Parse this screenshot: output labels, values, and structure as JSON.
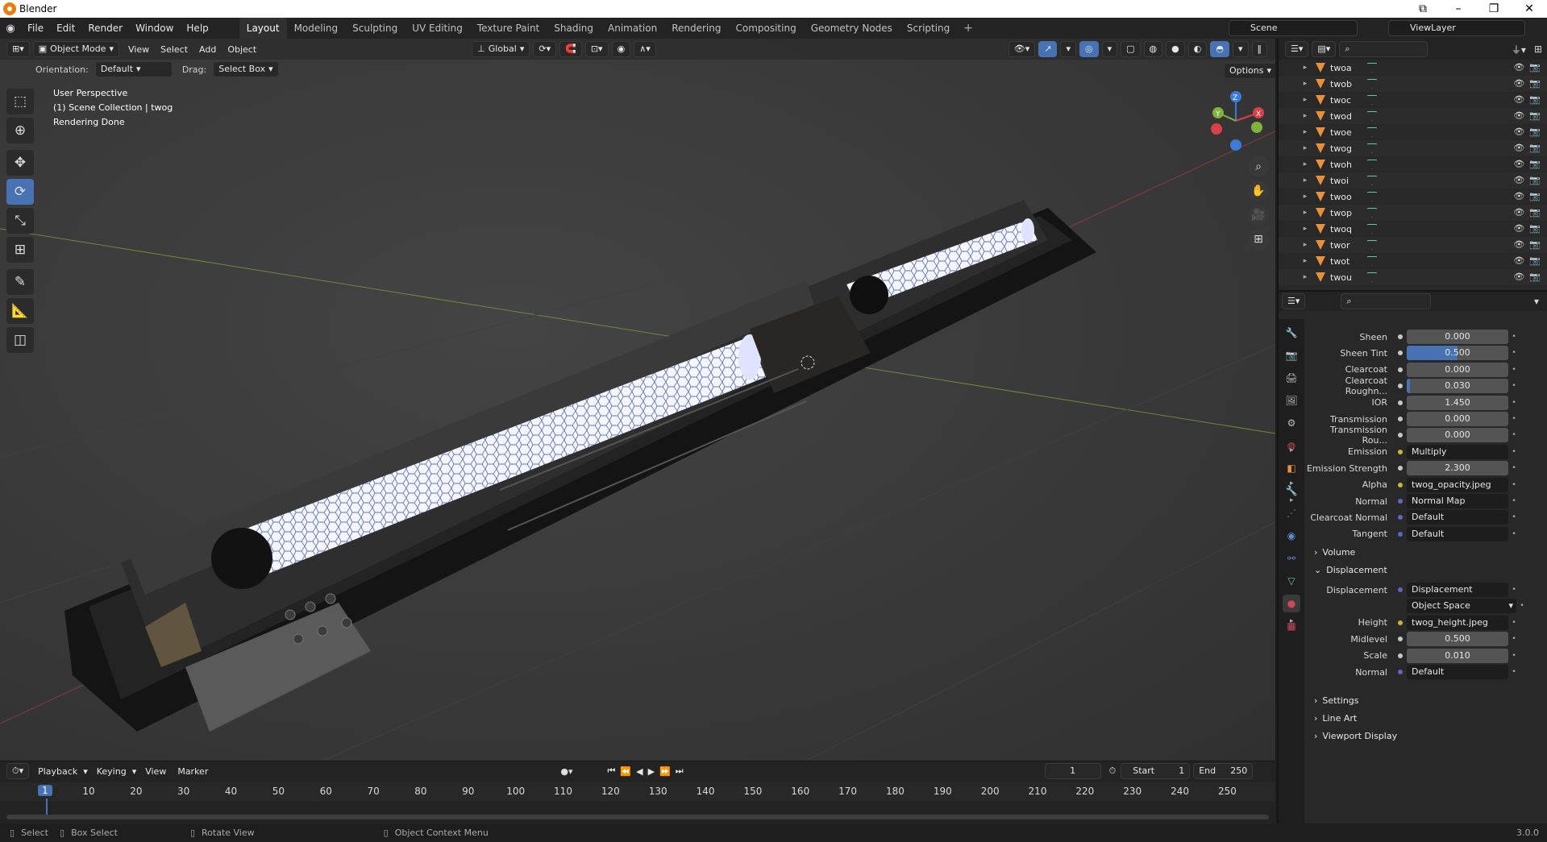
{
  "app": {
    "title": "Blender",
    "version": "3.0.0"
  },
  "menus": [
    "File",
    "Edit",
    "Render",
    "Window",
    "Help"
  ],
  "workspaces": [
    "Layout",
    "Modeling",
    "Sculpting",
    "UV Editing",
    "Texture Paint",
    "Shading",
    "Animation",
    "Rendering",
    "Compositing",
    "Geometry Nodes",
    "Scripting"
  ],
  "active_workspace": "Layout",
  "scene": {
    "name": "Scene",
    "view_layer": "ViewLayer"
  },
  "viewport": {
    "mode": "Object Mode",
    "menus": [
      "View",
      "Select",
      "Add",
      "Object"
    ],
    "transform": "Global",
    "orientation_label": "Orientation:",
    "orientation": "Default",
    "drag_label": "Drag:",
    "drag": "Select Box",
    "options": "Options",
    "overlay_lines": [
      "User Perspective",
      "(1) Scene Collection | twog",
      "Rendering Done"
    ]
  },
  "timeline": {
    "menus": [
      "Playback",
      "Keying",
      "View",
      "Marker"
    ],
    "current_frame": "1",
    "start_label": "Start",
    "start": "1",
    "end_label": "End",
    "end": "250",
    "ticks": [
      "10",
      "20",
      "30",
      "40",
      "50",
      "60",
      "70",
      "80",
      "90",
      "100",
      "110",
      "120",
      "130",
      "140",
      "150",
      "160",
      "170",
      "180",
      "190",
      "200",
      "210",
      "220",
      "230",
      "240",
      "250"
    ],
    "cur_tick": "1"
  },
  "statusbar": {
    "select": "Select",
    "box_select": "Box Select",
    "rotate": "Rotate View",
    "context": "Object Context Menu",
    "version": "3.0.0"
  },
  "outliner": {
    "items": [
      "twoa",
      "twob",
      "twoc",
      "twod",
      "twoe",
      "twog",
      "twoh",
      "twoi",
      "twoo",
      "twop",
      "twoq",
      "twor",
      "twot",
      "twou"
    ],
    "active": "twog"
  },
  "properties": {
    "rows": [
      {
        "label": "Sheen",
        "value": "0.000",
        "kind": "num",
        "fill": 0
      },
      {
        "label": "Sheen Tint",
        "value": "0.500",
        "kind": "num",
        "fill": 0.5
      },
      {
        "label": "Clearcoat",
        "value": "0.000",
        "kind": "num",
        "fill": 0
      },
      {
        "label": "Clearcoat Roughn...",
        "value": "0.030",
        "kind": "num",
        "fill": 0.03
      },
      {
        "label": "IOR",
        "value": "1.450",
        "kind": "num",
        "fill": 0
      },
      {
        "label": "Transmission",
        "value": "0.000",
        "kind": "num",
        "fill": 0
      },
      {
        "label": "Transmission Rou...",
        "value": "0.000",
        "kind": "num",
        "fill": 0
      },
      {
        "label": "Emission",
        "value": "Multiply",
        "kind": "link-y",
        "expand": true
      },
      {
        "label": "Emission Strength",
        "value": "2.300",
        "kind": "num",
        "fill": 0
      },
      {
        "label": "Alpha",
        "value": "twog_opacity.jpeg",
        "kind": "link-y",
        "expand": true
      },
      {
        "label": "Normal",
        "value": "Normal Map",
        "kind": "link-p",
        "expand": true
      },
      {
        "label": "Clearcoat Normal",
        "value": "Default",
        "kind": "link-p"
      },
      {
        "label": "Tangent",
        "value": "Default",
        "kind": "link-p"
      }
    ],
    "volume": "Volume",
    "displacement": "Displacement",
    "disp_rows": [
      {
        "label": "Displacement",
        "value": "Displacement",
        "kind": "link-p"
      },
      {
        "label": "",
        "value": "Object Space",
        "kind": "select"
      },
      {
        "label": "Height",
        "value": "twog_height.jpeg",
        "kind": "link-y",
        "expand": true
      },
      {
        "label": "Midlevel",
        "value": "0.500",
        "kind": "num",
        "fill": 0
      },
      {
        "label": "Scale",
        "value": "0.010",
        "kind": "num",
        "fill": 0
      },
      {
        "label": "Normal",
        "value": "Default",
        "kind": "link-p"
      }
    ],
    "settings": "Settings",
    "line_art": "Line Art",
    "viewport_display": "Viewport Display"
  }
}
